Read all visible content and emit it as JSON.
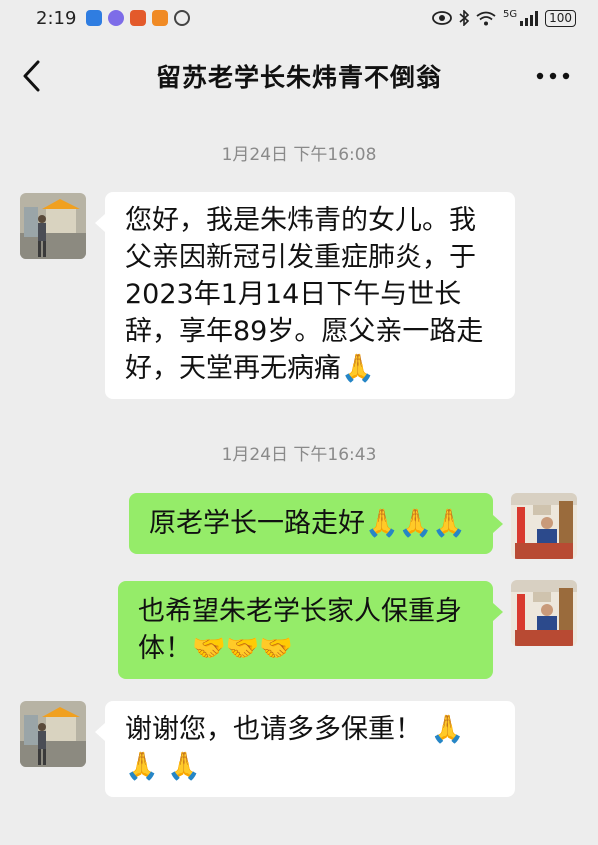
{
  "status_bar": {
    "time": "2:19",
    "network": "5G",
    "battery": "100"
  },
  "chat": {
    "title": "留苏老学长朱炜青不倒翁",
    "back_icon": "chevron-left-icon",
    "more_icon": "more-icon"
  },
  "timestamps": [
    "1月24日 下午16:08",
    "1月24日 下午16:43"
  ],
  "messages": [
    {
      "side": "in",
      "text": "您好，我是朱炜青的女儿。我父亲因新冠引发重症肺炎，于2023年1月14日下午与世长辞，享年89岁。愿父亲一路走好，天堂再无病痛🙏"
    },
    {
      "side": "out",
      "text": "原老学长一路走好🙏🙏🙏"
    },
    {
      "side": "out",
      "text": "也希望朱老学长家人保重身体！🤝🤝🤝"
    },
    {
      "side": "in",
      "text": "谢谢您，也请多多保重！ 🙏🙏 🙏"
    }
  ],
  "colors": {
    "background": "#ededed",
    "incoming_bubble": "#ffffff",
    "outgoing_bubble": "#95ec69",
    "timestamp": "#8a8a8a"
  }
}
